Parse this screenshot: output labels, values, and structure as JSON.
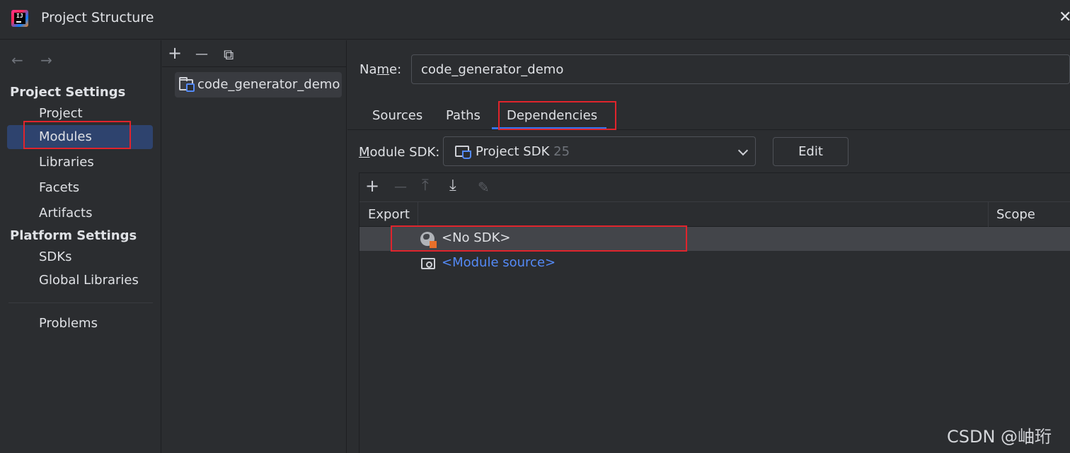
{
  "window": {
    "title": "Project Structure"
  },
  "nav": {
    "back": "←",
    "forward": "→",
    "project_settings_header": "Project Settings",
    "platform_settings_header": "Platform Settings",
    "items": [
      {
        "label": "Project"
      },
      {
        "label": "Modules"
      },
      {
        "label": "Libraries"
      },
      {
        "label": "Facets"
      },
      {
        "label": "Artifacts"
      },
      {
        "label": "SDKs"
      },
      {
        "label": "Global Libraries"
      },
      {
        "label": "Problems"
      }
    ]
  },
  "modules": {
    "toolbar": {
      "add": "+",
      "remove": "—",
      "copy": "⧉"
    },
    "items": [
      {
        "label": "code_generator_demo"
      }
    ]
  },
  "detail": {
    "name_label_pre": "Na",
    "name_label_u": "m",
    "name_label_post": "e:",
    "name_value": "code_generator_demo",
    "tabs": [
      {
        "label": "Sources"
      },
      {
        "label": "Paths"
      },
      {
        "label": "Dependencies"
      }
    ],
    "sdk_label_u": "M",
    "sdk_label_post": "odule SDK:",
    "sdk_value": "Project SDK",
    "sdk_version": "25",
    "edit_label": "Edit"
  },
  "dependencies": {
    "toolbar": {
      "add": "+",
      "remove": "—",
      "up": "⤒",
      "down": "⤓",
      "edit": "✎"
    },
    "columns": {
      "export": "Export",
      "scope": "Scope"
    },
    "rows": [
      {
        "label": "<No SDK>"
      },
      {
        "label": "<Module source>"
      }
    ]
  },
  "watermark": "CSDN @岫珩",
  "colors": {
    "accent": "#3574f0",
    "highlight": "#e0242c",
    "link": "#548af7",
    "selection": "#2e436e"
  }
}
